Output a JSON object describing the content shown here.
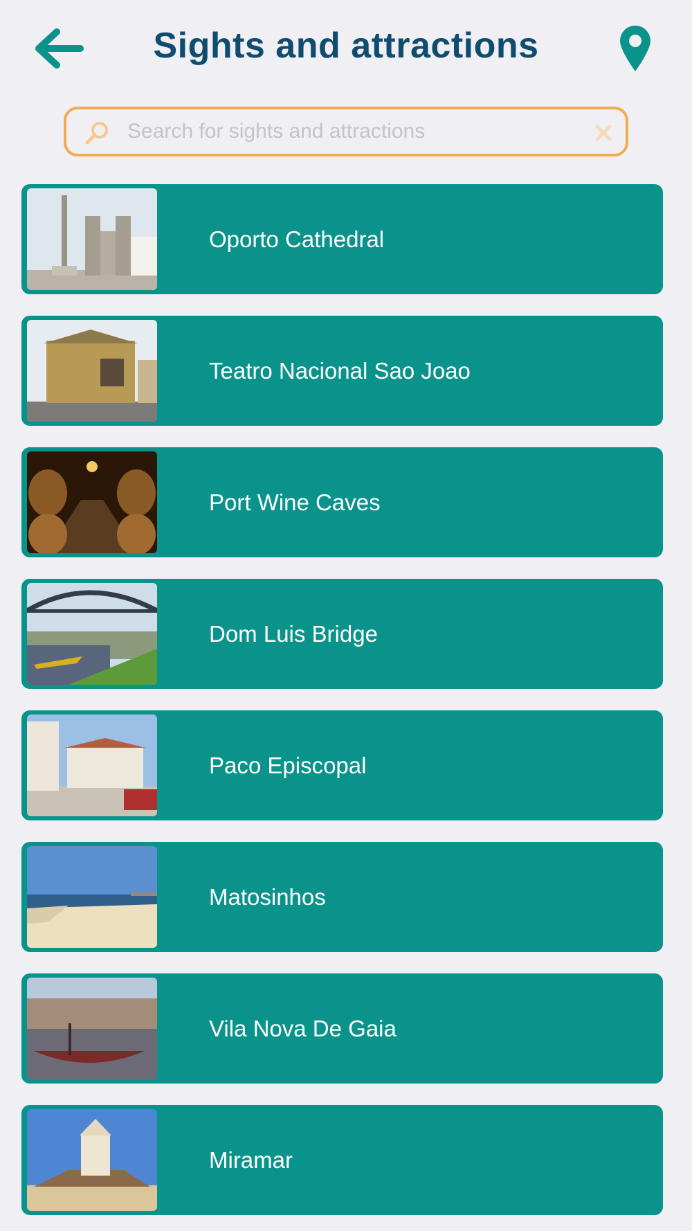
{
  "header": {
    "title": "Sights and attractions",
    "back_icon": "arrow-left-icon",
    "location_icon": "map-pin-icon"
  },
  "search": {
    "placeholder": "Search for sights and attractions",
    "value": "",
    "icon": "search-icon",
    "clear_icon": "close-icon"
  },
  "colors": {
    "background": "#efeff4",
    "accent": "#0a938b",
    "title": "#0f4c6e",
    "search_border": "#f3ab4c"
  },
  "items": [
    {
      "label": "Oporto Cathedral",
      "thumbnail": "cathedral-photo"
    },
    {
      "label": "Teatro Nacional Sao Joao",
      "thumbnail": "theatre-photo"
    },
    {
      "label": "Port Wine Caves",
      "thumbnail": "wine-cellar-photo"
    },
    {
      "label": "Dom Luis Bridge",
      "thumbnail": "bridge-photo"
    },
    {
      "label": "Paco Episcopal",
      "thumbnail": "palace-photo"
    },
    {
      "label": "Matosinhos",
      "thumbnail": "beach-photo"
    },
    {
      "label": "Vila Nova De Gaia",
      "thumbnail": "riverside-boat-photo"
    },
    {
      "label": "Miramar",
      "thumbnail": "chapel-photo"
    }
  ]
}
